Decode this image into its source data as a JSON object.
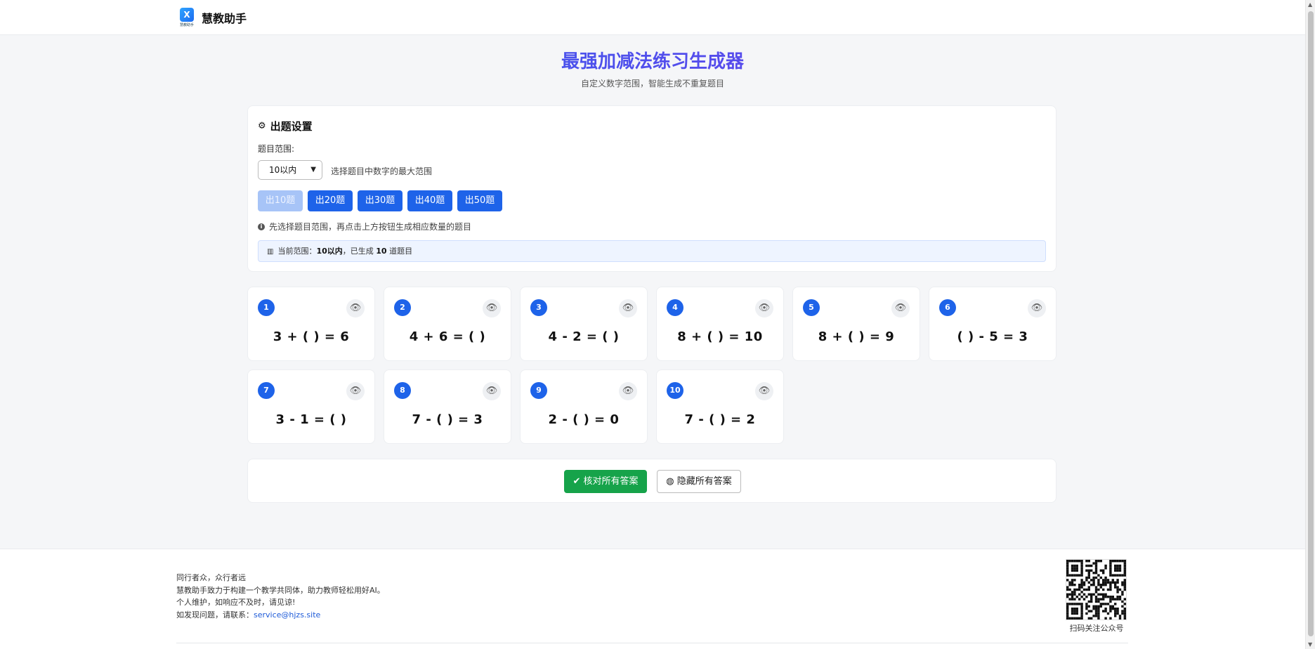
{
  "header": {
    "logo_mark": "X",
    "logo_caption": "慧教助手",
    "brand": "慧教助手"
  },
  "hero": {
    "title": "最强加减法练习生成器",
    "subtitle": "自定义数字范围，智能生成不重复题目"
  },
  "settings": {
    "title": "出题设置",
    "range_label": "题目范围:",
    "range_selected": "10以内",
    "range_hint": "选择题目中数字的最大范围",
    "buttons": [
      "出10题",
      "出20题",
      "出30题",
      "出40题",
      "出50题"
    ],
    "active_button_index": 0,
    "tip": "先选择题目范围，再点击上方按钮生成相应数量的题目",
    "status_prefix": "当前范围：",
    "status_range": "10以内",
    "status_mid": "，已生成 ",
    "status_count": "10",
    "status_suffix": " 道题目"
  },
  "questions": [
    {
      "num": "1",
      "expr": "3 + ( ) = 6"
    },
    {
      "num": "2",
      "expr": "4 + 6 = ( )"
    },
    {
      "num": "3",
      "expr": "4 - 2 = ( )"
    },
    {
      "num": "4",
      "expr": "8 + ( ) = 10"
    },
    {
      "num": "5",
      "expr": "8 + ( ) = 9"
    },
    {
      "num": "6",
      "expr": "( ) - 5 = 3"
    },
    {
      "num": "7",
      "expr": "3 - 1 = ( )"
    },
    {
      "num": "8",
      "expr": "7 - ( ) = 3"
    },
    {
      "num": "9",
      "expr": "2 - ( ) = 0"
    },
    {
      "num": "10",
      "expr": "7 - ( ) = 2"
    }
  ],
  "actions": {
    "check_all": "核对所有答案",
    "hide_all": "隐藏所有答案"
  },
  "footer": {
    "line1": "同行者众，众行者远",
    "line2": "慧教助手致力于构建一个教学共同体，助力教师轻松用好AI。",
    "line3": "个人维护，如响应不及时，请见谅!",
    "line4_prefix": "如发现问题，请联系：",
    "email": "service@hjzs.site",
    "qr_caption": "扫码关注公众号"
  },
  "colors": {
    "accent": "#1e63e9",
    "success": "#16a34a",
    "title_gradient_start": "#2563eb",
    "title_gradient_end": "#7c3aed"
  },
  "icons": {
    "settings": "gear-icon",
    "tip": "info-icon",
    "status": "bar-chart-icon",
    "reveal": "eye-icon",
    "check": "check-icon",
    "hide": "eye-slash-icon"
  }
}
